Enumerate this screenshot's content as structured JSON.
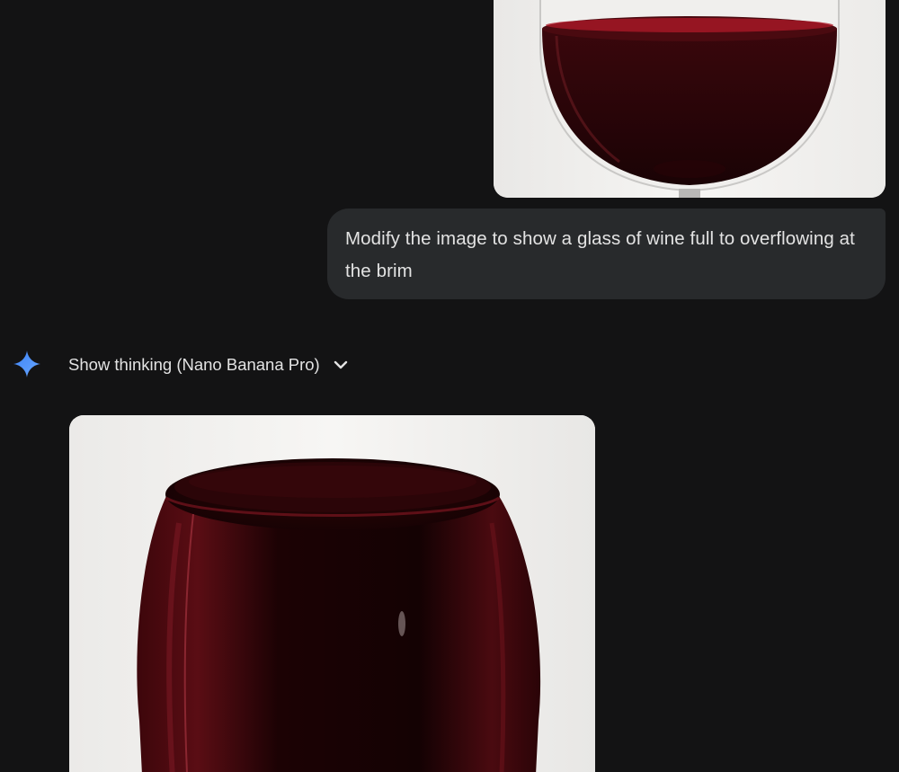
{
  "conversation": {
    "user_image": {
      "icon": "photo-wine-glass"
    },
    "user_message": {
      "text": "Modify the image to show a glass of wine full to overflowing at the brim"
    },
    "assistant": {
      "spark_icon": "gemini-spark-icon",
      "thinking_toggle_label": "Show thinking (Nano Banana Pro)",
      "chevron_icon": "chevron-down-icon"
    },
    "generated_image": {
      "icon": "photo-overflowing-wine-glass"
    }
  },
  "colors": {
    "background": "#131314",
    "bubble": "#282a2c",
    "text": "#e3e3e3",
    "spark_accent": "#4a8cff",
    "wine": "#2a0508"
  }
}
